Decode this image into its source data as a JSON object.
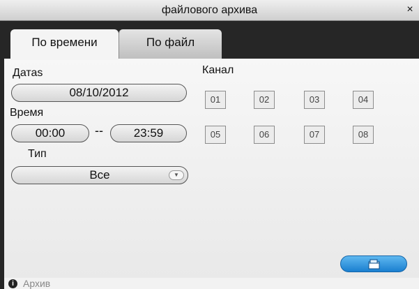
{
  "window": {
    "title": "файлового архива",
    "close_glyph": "×"
  },
  "tabs": [
    {
      "label": "По времени",
      "active": true
    },
    {
      "label": "По файл",
      "active": false
    }
  ],
  "date": {
    "label": "Датаs",
    "value": "08/10/2012"
  },
  "time": {
    "label": "Время",
    "from": "00:00",
    "separator": "--",
    "to": "23:59"
  },
  "type": {
    "label": "Тип",
    "selected": "Все"
  },
  "channels": {
    "label": "Канал",
    "items": [
      "01",
      "02",
      "03",
      "04",
      "05",
      "06",
      "07",
      "08"
    ]
  },
  "toolbar": {
    "action_icon": "folder-open-icon",
    "accent": "#2a8ee0"
  },
  "status": {
    "icon": "info-icon",
    "text": "Архив"
  }
}
